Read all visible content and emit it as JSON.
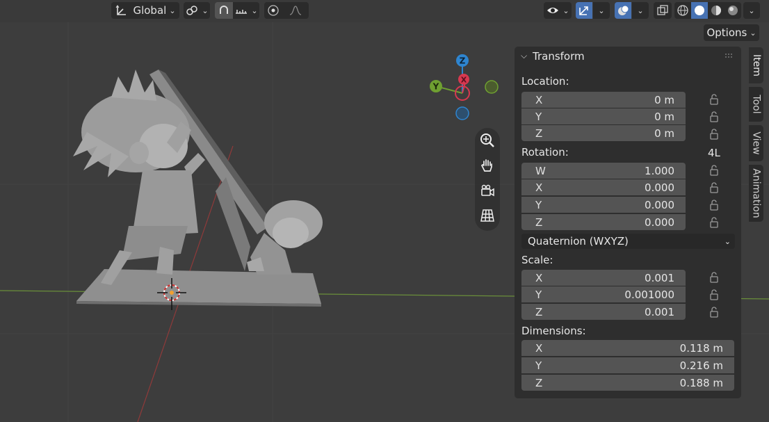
{
  "header": {
    "transform_orientation": "Global",
    "options_label": "Options"
  },
  "gizmo": {
    "z_label": "Z",
    "y_label": "Y",
    "x_label": "X",
    "colors": {
      "x": "#d7384f",
      "y": "#6fa031",
      "z": "#2e85d0"
    }
  },
  "panel": {
    "title": "Transform",
    "location_label": "Location:",
    "location": [
      {
        "axis": "X",
        "value": "0 m"
      },
      {
        "axis": "Y",
        "value": "0 m"
      },
      {
        "axis": "Z",
        "value": "0 m"
      }
    ],
    "rotation_label": "Rotation:",
    "rotation_lock_label": "4L",
    "rotation": [
      {
        "axis": "W",
        "value": "1.000"
      },
      {
        "axis": "X",
        "value": "0.000"
      },
      {
        "axis": "Y",
        "value": "0.000"
      },
      {
        "axis": "Z",
        "value": "0.000"
      }
    ],
    "rotation_mode": "Quaternion (WXYZ)",
    "scale_label": "Scale:",
    "scale": [
      {
        "axis": "X",
        "value": "0.001"
      },
      {
        "axis": "Y",
        "value": "0.001000"
      },
      {
        "axis": "Z",
        "value": "0.001"
      }
    ],
    "dimensions_label": "Dimensions:",
    "dimensions": [
      {
        "axis": "X",
        "value": "0.118 m"
      },
      {
        "axis": "Y",
        "value": "0.216 m"
      },
      {
        "axis": "Z",
        "value": "0.188 m"
      }
    ]
  },
  "tabs": [
    {
      "label": "Item",
      "active": true
    },
    {
      "label": "Tool",
      "active": false
    },
    {
      "label": "View",
      "active": false
    },
    {
      "label": "Animation",
      "active": false
    }
  ],
  "colors": {
    "accent": "#4772b3",
    "panel_bg": "#2e2e2e",
    "field_bg": "#545454",
    "viewport_bg": "#3d3d3d"
  }
}
